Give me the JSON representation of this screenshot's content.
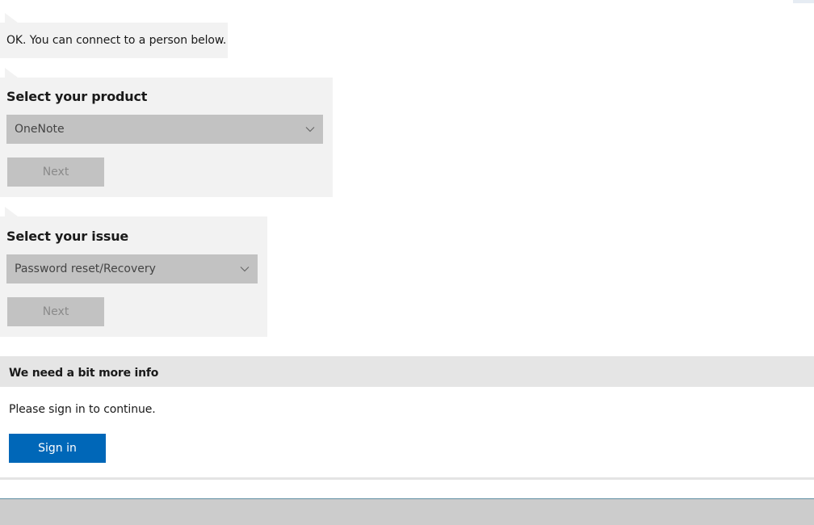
{
  "message": {
    "text": "OK. You can connect to a person below."
  },
  "product_card": {
    "title": "Select your product",
    "selected_value": "OneNote",
    "next_label": "Next"
  },
  "issue_card": {
    "title": "Select your issue",
    "selected_value": "Password reset/Recovery",
    "next_label": "Next"
  },
  "info_panel": {
    "header": "We need a bit more info",
    "body": "Please sign in to continue.",
    "signin_label": "Sign in"
  },
  "colors": {
    "bubble_bg": "#f2f2f2",
    "select_bg": "#c2c2c2",
    "disabled_text": "#8a8a8a",
    "primary_button": "#0067b8",
    "info_header_bg": "#e5e5e5"
  },
  "icons": {
    "dropdown": "chevron-down-icon"
  }
}
